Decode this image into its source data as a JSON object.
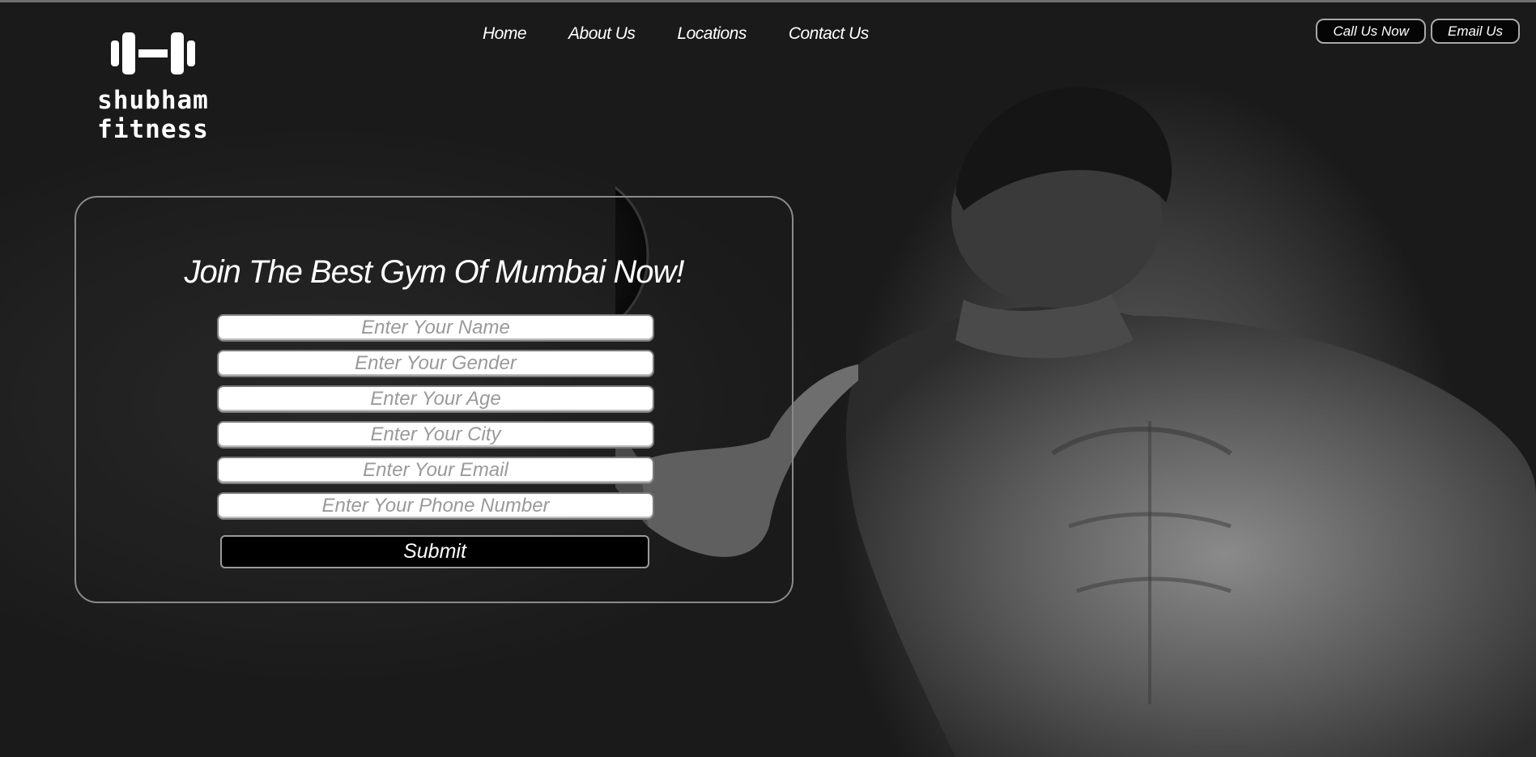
{
  "brand": {
    "name": "shubham fitness",
    "logo_icon": "dumbbell-icon"
  },
  "nav": {
    "items": [
      {
        "label": "Home"
      },
      {
        "label": "About Us"
      },
      {
        "label": "Locations"
      },
      {
        "label": "Contact Us"
      }
    ]
  },
  "header_actions": {
    "call_label": "Call Us Now",
    "email_label": "Email Us"
  },
  "form": {
    "title": "Join The Best Gym Of Mumbai Now!",
    "fields": {
      "name_placeholder": "Enter Your Name",
      "gender_placeholder": "Enter Your Gender",
      "age_placeholder": "Enter Your Age",
      "city_placeholder": "Enter Your City",
      "email_placeholder": "Enter Your Email",
      "phone_placeholder": "Enter Your Phone Number"
    },
    "submit_label": "Submit"
  },
  "colors": {
    "background": "#1a1a1a",
    "text": "#ffffff",
    "input_background": "#ffffff",
    "submit_background": "#000000"
  }
}
